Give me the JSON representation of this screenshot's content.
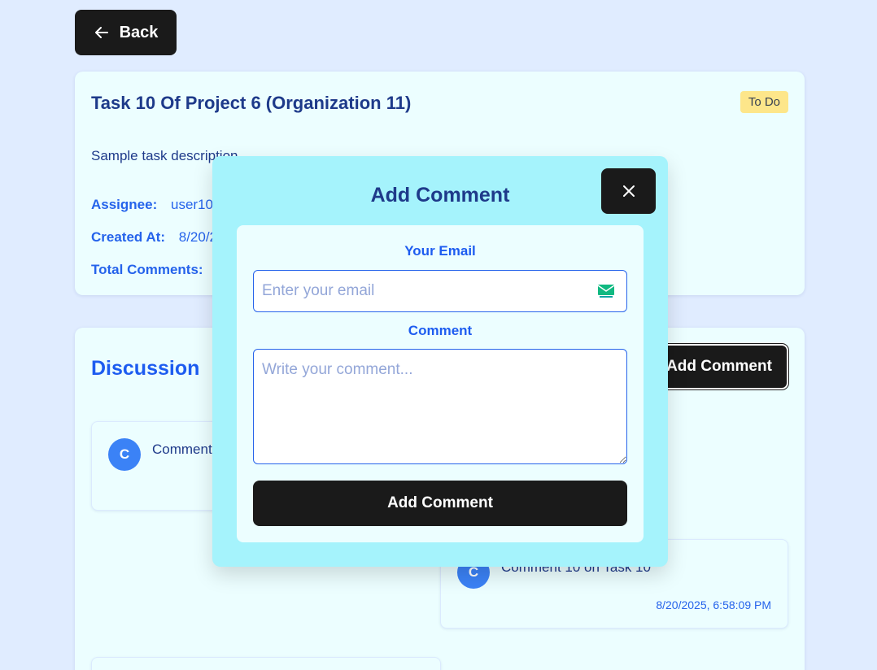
{
  "back_button": {
    "label": "Back",
    "icon": "arrow-left-icon"
  },
  "task": {
    "title": "Task 10 Of Project 6 (Organization 11)",
    "status": "To Do",
    "status_color": "#fde68a",
    "description": "Sample task description",
    "assignee_label": "Assignee:",
    "assignee_value": "user10@",
    "created_label": "Created At:",
    "created_value": "8/20/2",
    "total_comments_label": "Total Comments:"
  },
  "discussion": {
    "title": "Discussion",
    "add_button_label": "Add Comment",
    "comments": [
      {
        "avatar": "C",
        "text": "Comment",
        "time": ""
      },
      {
        "avatar": "C",
        "text": "Comment 10 on Task 10",
        "time": "8/20/2025, 6:58:09 PM"
      }
    ]
  },
  "modal": {
    "title": "Add Comment",
    "close_icon": "close-icon",
    "email_label": "Your Email",
    "email_placeholder": "Enter your email",
    "email_icon": "mail-icon",
    "comment_label": "Comment",
    "comment_placeholder": "Write your comment...",
    "submit_label": "Add Comment"
  },
  "colors": {
    "page_bg": "#e0ecff",
    "card_bg": "#ecfeff",
    "modal_bg": "#a5f3fc",
    "button_bg": "#1a1a1a",
    "accent": "#2563eb",
    "avatar_bg": "#3b82f6"
  }
}
